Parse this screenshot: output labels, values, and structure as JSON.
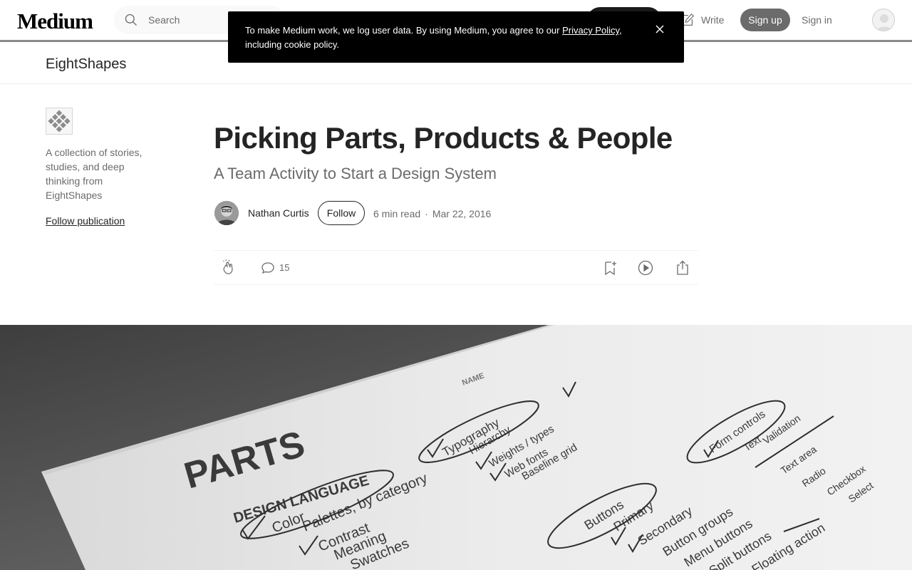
{
  "nav": {
    "logo": "Medium",
    "search_placeholder": "Search",
    "write_label": "Write",
    "signup_label": "Sign up",
    "signin_label": "Sign in"
  },
  "cookie_banner": {
    "text_before": "To make Medium work, we log user data. By using Medium, you agree to our ",
    "link": "Privacy Policy",
    "text_after": ", including cookie policy."
  },
  "publication": {
    "name": "EightShapes",
    "description": "A collection of stories, studies, and deep thinking from EightShapes",
    "follow_label": "Follow publication"
  },
  "article": {
    "title": "Picking Parts, Products & People",
    "subtitle": "A Team Activity to Start a Design System",
    "author": "Nathan Curtis",
    "follow_label": "Follow",
    "read_time": "6 min read",
    "separator": "·",
    "date": "Mar 22, 2016",
    "responses": "15"
  },
  "hero_text": {
    "heading": "PARTS",
    "section": "DESIGN LANGUAGE",
    "items": [
      "Color",
      "Palettes, by category",
      "Contrast",
      "Meaning",
      "Swatches"
    ],
    "typography": [
      "Typography",
      "Hierarchy",
      "Weights / types",
      "Web fonts",
      "Baseline grid"
    ],
    "buttons": [
      "Buttons",
      "Primary",
      "Secondary",
      "Button groups",
      "Menu buttons",
      "Split buttons",
      "Floating action"
    ],
    "forms": [
      "Form controls",
      "Text",
      "Validation",
      "Text area",
      "Radio",
      "Checkbox",
      "Select"
    ],
    "name_label": "NAME"
  },
  "icons": {
    "search": "search-icon",
    "write": "write-icon",
    "close": "close-icon",
    "clap": "clap-icon",
    "response": "response-icon",
    "save": "bookmark-icon",
    "listen": "play-icon",
    "share": "share-icon"
  }
}
